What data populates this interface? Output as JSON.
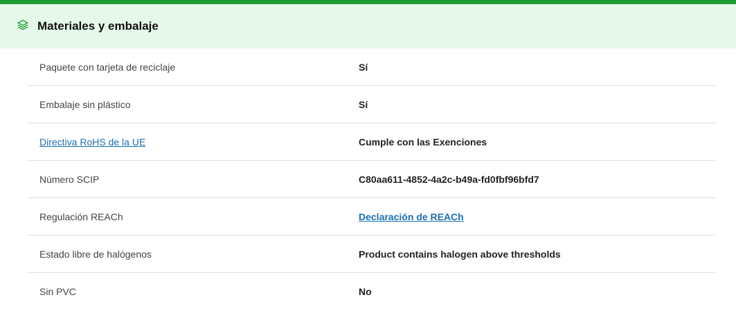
{
  "section": {
    "title": "Materiales y embalaje",
    "icon": "layers-icon",
    "accent_color": "#1e9a32",
    "header_bg": "#e6f8e9"
  },
  "rows": [
    {
      "label": "Paquete con tarjeta de reciclaje",
      "value": "Sí"
    },
    {
      "label": "Embalaje sin plástico",
      "value": "Sí"
    },
    {
      "label": "Directiva RoHS de la UE",
      "value": "Cumple con las Exenciones",
      "label_is_link": true
    },
    {
      "label": "Número SCIP",
      "value": "C80aa611-4852-4a2c-b49a-fd0fbf96bfd7"
    },
    {
      "label": "Regulación REACh",
      "value": "Declaración de REACh",
      "value_is_link": true
    },
    {
      "label": "Estado libre de halógenos",
      "value": "Product contains halogen above thresholds"
    },
    {
      "label": "Sin PVC",
      "value": "No"
    }
  ]
}
